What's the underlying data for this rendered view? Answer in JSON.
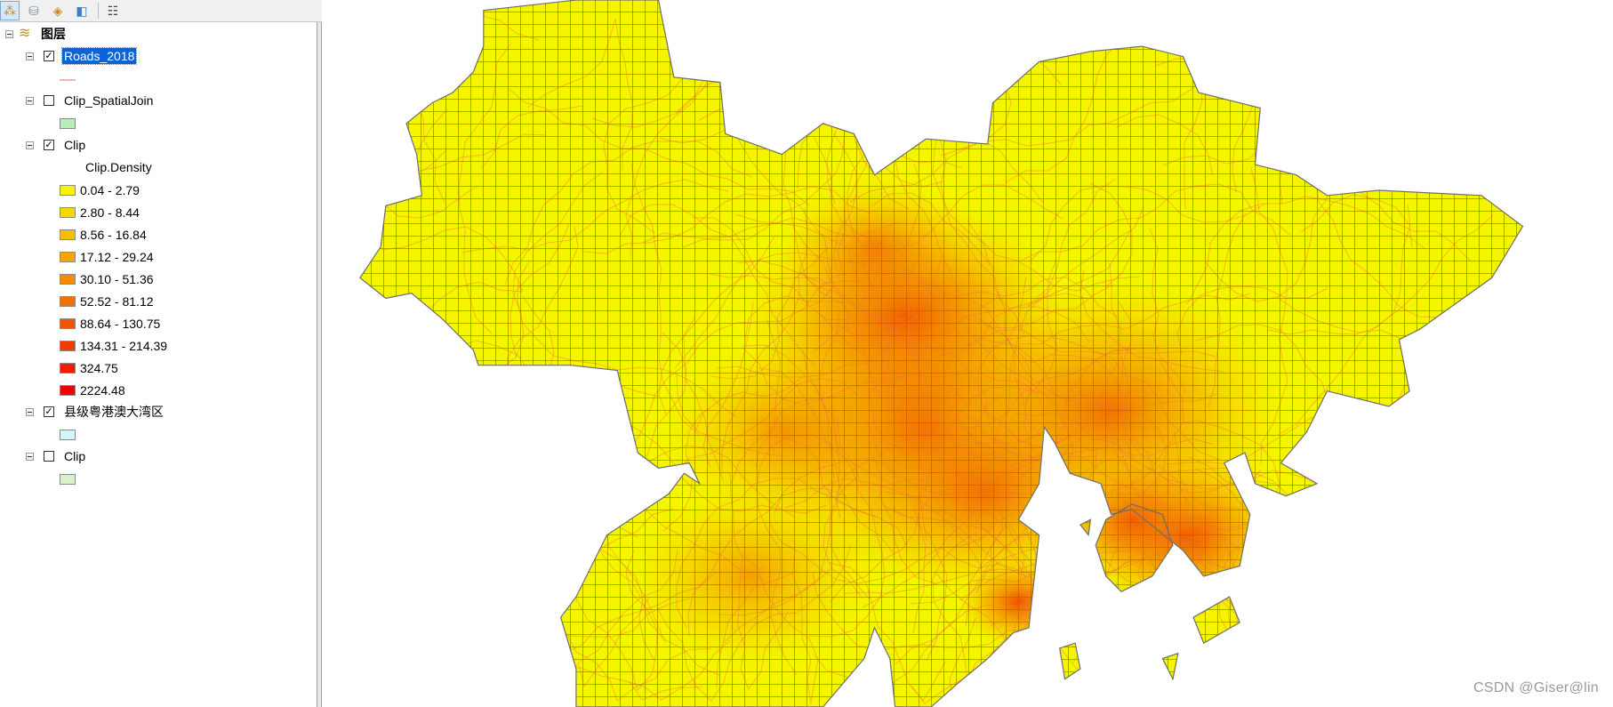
{
  "toolbar": {
    "buttons": [
      {
        "name": "list-by-drawing-order",
        "icon": "list-drawing-order-icon",
        "active": true
      },
      {
        "name": "list-by-source",
        "icon": "database-icon"
      },
      {
        "name": "list-by-visibility",
        "icon": "layers-icon"
      },
      {
        "name": "list-by-selection",
        "icon": "selection-icon"
      },
      {
        "name": "options",
        "icon": "options-list-icon"
      }
    ]
  },
  "toc": {
    "root_label": "图层",
    "layers": [
      {
        "name": "Roads_2018",
        "checked": true,
        "selected": true,
        "symbol": {
          "type": "line",
          "color": "#f4b4b4"
        }
      },
      {
        "name": "Clip_SpatialJoin",
        "checked": false,
        "symbol": {
          "type": "fill",
          "color": "#b8eeb8"
        }
      },
      {
        "name": "Clip",
        "checked": true,
        "field": "Clip.Density",
        "classes": [
          {
            "label": "0.04 - 2.79",
            "color": "#f5f500"
          },
          {
            "label": "2.80 - 8.44",
            "color": "#f5d800"
          },
          {
            "label": "8.56 - 16.84",
            "color": "#f5be00"
          },
          {
            "label": "17.12 - 29.24",
            "color": "#f5a500"
          },
          {
            "label": "30.10 - 51.36",
            "color": "#f58c00"
          },
          {
            "label": "52.52 - 81.12",
            "color": "#f27000"
          },
          {
            "label": "88.64 - 130.75",
            "color": "#f05500"
          },
          {
            "label": "134.31 - 214.39",
            "color": "#f03c00"
          },
          {
            "label": "324.75",
            "color": "#f01e00"
          },
          {
            "label": "2224.48",
            "color": "#f00000"
          }
        ]
      },
      {
        "name": "县级粤港澳大湾区",
        "checked": true,
        "symbol": {
          "type": "fill",
          "color": "#d4f5f8"
        }
      },
      {
        "name": "Clip",
        "checked": false,
        "symbol": {
          "type": "fill",
          "color": "#daf0cc"
        }
      }
    ]
  },
  "map": {
    "grid_color": "#6e6e6e",
    "road_color": "#f07838",
    "outline_color": "#6e6e6e"
  },
  "watermark": "CSDN @Giser@lin"
}
